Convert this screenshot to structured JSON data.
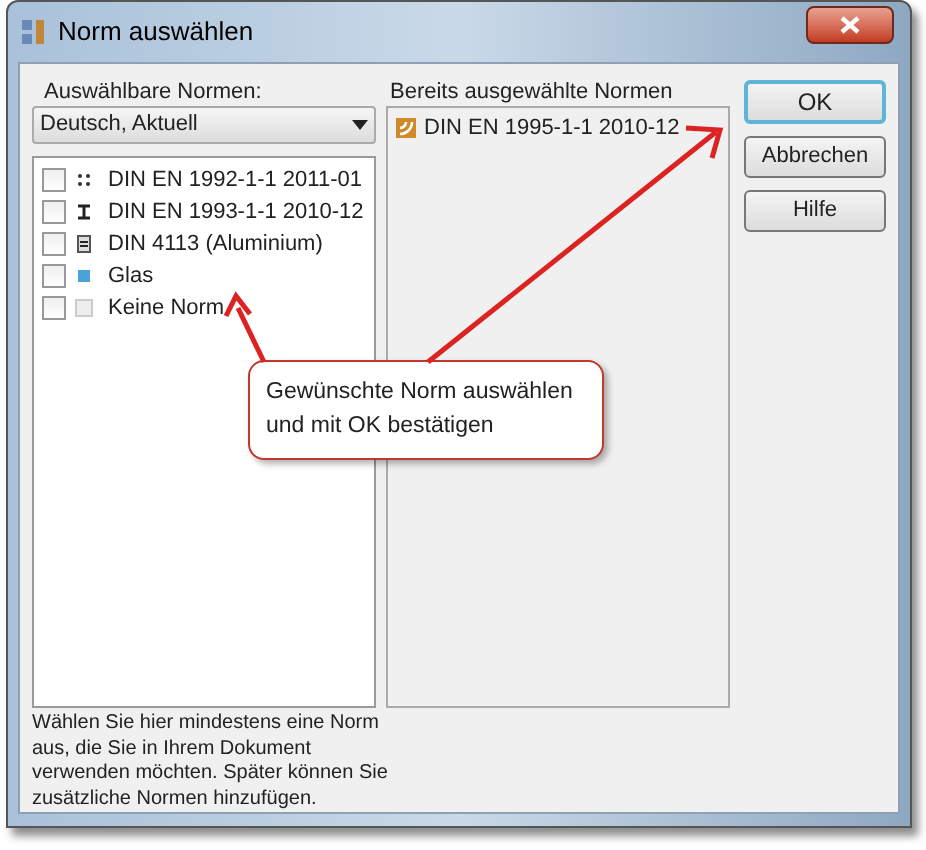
{
  "window": {
    "title": "Norm auswählen"
  },
  "available": {
    "label": "Auswählbare Normen:",
    "dropdown": {
      "value": "Deutsch, Aktuell"
    },
    "items": [
      {
        "label": "DIN EN 1992-1-1 2011-01",
        "kind": "concrete",
        "checked": false
      },
      {
        "label": "DIN EN 1993-1-1 2010-12",
        "kind": "steel",
        "checked": false
      },
      {
        "label": "DIN 4113 (Aluminium)",
        "kind": "aluminium",
        "checked": false
      },
      {
        "label": "Glas",
        "kind": "glass",
        "checked": false
      },
      {
        "label": "Keine Norm",
        "kind": "none",
        "checked": false
      }
    ],
    "hint": "Wählen Sie hier mindestens eine Norm aus, die Sie in Ihrem Dokument verwenden möchten. Später können Sie zusätzliche Normen hinzufügen."
  },
  "selected": {
    "label": "Bereits ausgewählte Normen",
    "items": [
      {
        "label": "DIN EN 1995-1-1 2010-12",
        "kind": "timber"
      }
    ]
  },
  "buttons": [
    {
      "label": "OK",
      "default": true
    },
    {
      "label": "Abbrechen",
      "default": false
    },
    {
      "label": "Hilfe",
      "default": false
    }
  ],
  "callout": {
    "lines": [
      "Gewünschte Norm auswählen",
      "und mit OK bestätigen"
    ]
  }
}
